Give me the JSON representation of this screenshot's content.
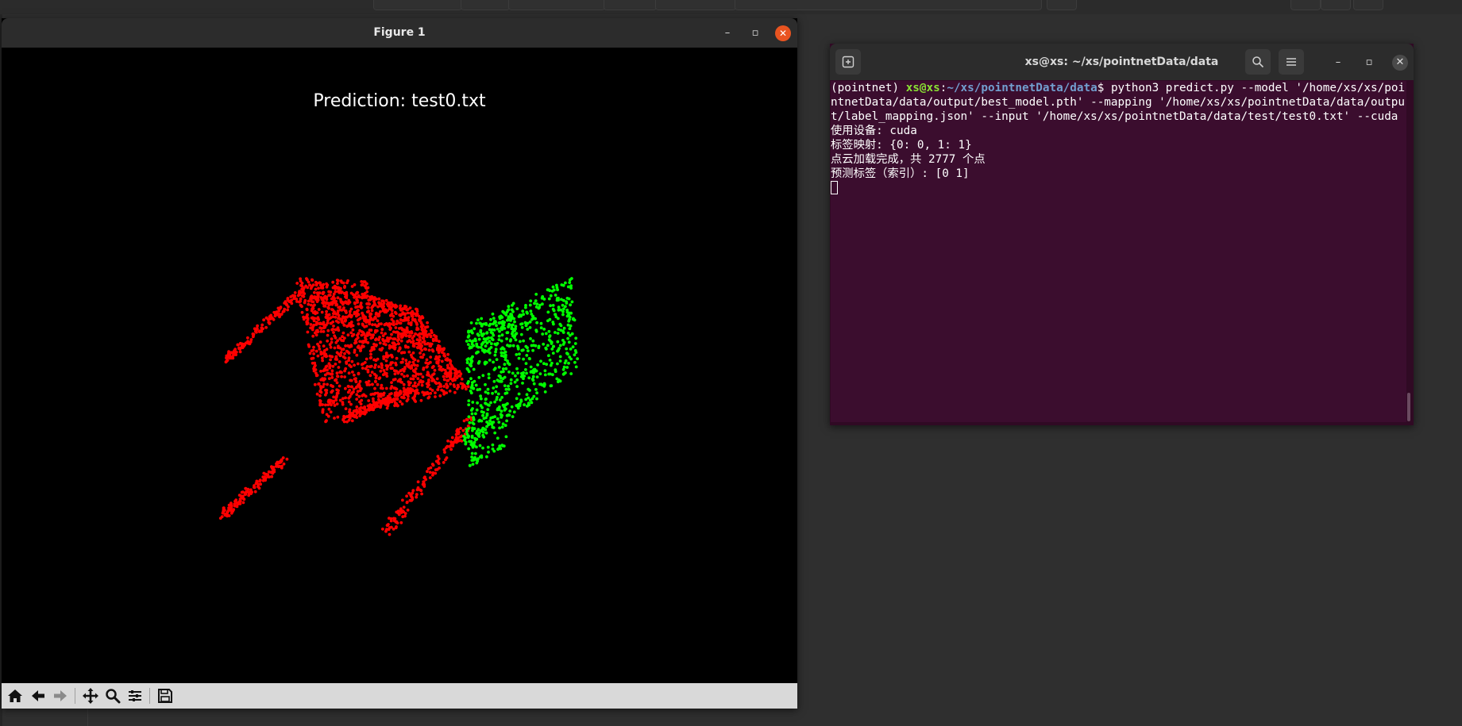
{
  "figure_window": {
    "title": "Figure 1",
    "minimize_glyph": "–",
    "maximize_glyph": "▫",
    "close_glyph": "✕",
    "plot_title": "Prediction: test0.txt",
    "toolbar_icons": [
      "home-icon",
      "back-arrow-icon",
      "forward-arrow-icon",
      "pan-icon",
      "zoom-icon",
      "configure-subplots-icon",
      "save-icon"
    ]
  },
  "chart_data": {
    "type": "scatter",
    "title": "Prediction: test0.txt",
    "series": [
      {
        "color": "#ff0000",
        "description_shape": "chair seat, back, legs"
      },
      {
        "color": "#00ff00"
      }
    ],
    "point_count": 2777,
    "axes_visible": false,
    "background": "#000000"
  },
  "terminal": {
    "title": "xs@xs: ~/xs/pointnetData/data",
    "minimize_glyph": "–",
    "maximize_glyph": "▫",
    "close_glyph": "✕",
    "prompt_env": "(pointnet) ",
    "prompt_user": "xs@xs",
    "prompt_sep": ":",
    "prompt_path": "~/xs/pointnetData/data",
    "prompt_dollar": "$ ",
    "command": "python3 predict.py --model '/home/xs/xs/pointnetData/data/output/best_model.pth' --mapping '/home/xs/xs/pointnetData/data/output/label_mapping.json' --input '/home/xs/xs/pointnetData/data/test/test0.txt' --cuda",
    "output_lines": [
      "使用设备: cuda",
      "标签映射: {0: 0, 1: 1}",
      "点云加载完成，共 2777 个点",
      "预测标签（索引）: [0 1]"
    ]
  }
}
